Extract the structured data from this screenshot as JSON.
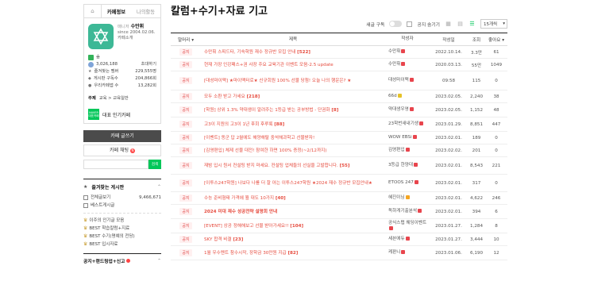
{
  "sidebar": {
    "tabs": [
      "카페정보",
      "나의활동"
    ],
    "manager": {
      "role": "매니저",
      "name": "수만휘",
      "since": "since 2004.02.06.",
      "intro": "카페소개"
    },
    "stats": {
      "grade": "숲",
      "members": "3,026,188",
      "invite": "초대하기",
      "fav_members_label": "즐겨찾는 멤버",
      "fav_members_value": "229,555명",
      "subscribe_label": "게시판 구독수",
      "subscribe_value": "204,866회",
      "town_label": "우리카페앱 수",
      "town_value": "13,282회"
    },
    "subject": {
      "label": "주제",
      "value": "교육 > 교육일반"
    },
    "ranking": {
      "badge": "NAVER 대표카페",
      "label": "대표 인기카페"
    },
    "write_button": "카페 글쓰기",
    "chat_button": "카페 채팅",
    "search_button": "검색",
    "favorites_title": "즐겨찾는 게시판",
    "menu": [
      {
        "label": "전체글보기",
        "value": "9,466,671"
      },
      {
        "label": "베스트게시글",
        "value": ""
      }
    ],
    "best_menu": [
      {
        "label": "이주의 인기글 모음"
      },
      {
        "label": "BEST 학습칼럼+지료"
      },
      {
        "label": "BEST 수기(명예의 전당)"
      },
      {
        "label": "BEST 입시자료"
      }
    ],
    "bottom_title": "공지+랜드링업+신고"
  },
  "main": {
    "title": "칼럼+수기+자료 기고",
    "toolbar": {
      "subscribe": "새글 구독",
      "hide_notice": "공지 숨기기",
      "per_page": "15개씩"
    },
    "headers": {
      "head": "말머리",
      "title": "제목",
      "author": "작성자",
      "date": "작성일",
      "views": "조회",
      "likes": "좋아요"
    },
    "rows": [
      {
        "head": "공지",
        "title": "수만휘 스피드타, 기숙학원 재수 정규반 모집 안내",
        "comments": "[522]",
        "author": "수만휘",
        "level": "r",
        "date": "2022.10.14.",
        "views": "3.3만",
        "likes": "61",
        "bold": false
      },
      {
        "head": "공지",
        "title": "현재 가장 인강패스+권 사장 주요 교육기관 이벤트 모음-2.5 update",
        "comments": "",
        "author": "수만휘",
        "level": "r",
        "date": "2020.03.13.",
        "views": "55만",
        "likes": "1049",
        "bold": false
      },
      {
        "head": "공지",
        "title": "[대성마이맥] ★마이맥터로★ 신규회원 100% 선물 당첨! 오늘 나의 행운은? ★",
        "comments": "",
        "author": "대성마이맥",
        "level": "r",
        "date": "09:58",
        "views": "115",
        "likes": "0",
        "bold": false
      },
      {
        "head": "공지",
        "title": "모두 소환 받고 가세요",
        "comments": "[218]",
        "author": "66d",
        "level": "y",
        "date": "2023.02.05.",
        "views": "2,240",
        "likes": "38",
        "bold": false
      },
      {
        "head": "공지",
        "title": "[학원] 상위 1.3% 약대생이 알려주는 1등급 받는 공부방법 - 단권화",
        "comments": "[8]",
        "author": "약대생우영",
        "level": "r",
        "date": "2023.02.05.",
        "views": "1,152",
        "likes": "48",
        "bold": false
      },
      {
        "head": "공지",
        "title": "고3이 지원의 고3이 1년 후회 후루룩",
        "comments": "[88]",
        "author": "23학번새내기생",
        "level": "r",
        "date": "2023.01.29.",
        "views": "8,851",
        "likes": "447",
        "bold": false
      },
      {
        "head": "공지",
        "title": "[이벤트] 동군 답 2월에도 해양해탈 중석해과학고 선물받자!",
        "comments": "",
        "author": "WOW EBSi",
        "level": "r",
        "date": "2023.02.01.",
        "views": "189",
        "likes": "0",
        "bold": false
      },
      {
        "head": "공지",
        "title": "[김영편입] 체제 선물 대전! 참여한 하면 100% 증정(~2/12까지)",
        "comments": "",
        "author": "김영편입",
        "level": "r",
        "date": "2023.02.02.",
        "views": "201",
        "likes": "0",
        "bold": false
      },
      {
        "head": "공지",
        "title": "재밤 입시 원서 컨설팅 받지 마세요. 컨설팅 업체들의 선실을 고발합니다.",
        "comments": "[55]",
        "author": "3등급 한양대",
        "level": "r",
        "date": "2023.02.01.",
        "views": "8,543",
        "likes": "221",
        "bold": false
      },
      {
        "head": "공지",
        "title": "[이투스247학원] 나보다 나를 더 잘 아는 이투스247학원 ★2024 재수 정규반 모집안내★",
        "comments": "",
        "author": "ETOOS 247",
        "level": "r",
        "date": "2023.02.01.",
        "views": "317",
        "likes": "0",
        "bold": false
      },
      {
        "head": "공지",
        "title": "수능 준비형태 가격에 뭘 대도 10가지",
        "comments": "[40]",
        "author": "혜진이님",
        "level": "o",
        "date": "2023.02.01.",
        "views": "4,622",
        "likes": "246",
        "bold": false
      },
      {
        "head": "공지",
        "title": "2024 미대 재수 성공전략 설명회 안내",
        "comments": "",
        "author": "독하게기출분석",
        "level": "r",
        "date": "2023.02.01.",
        "views": "394",
        "likes": "6",
        "bold": true
      },
      {
        "head": "공지",
        "title": "[EVENT] 상공 정해해보고 선물 받아가세요!!",
        "comments": "[104]",
        "author": "공식스탭 웨딩이벤트",
        "level": "r",
        "date": "2023.01.27.",
        "views": "1,284",
        "likes": "8",
        "bold": false
      },
      {
        "head": "공지",
        "title": "SKY 합격 비결",
        "comments": "[23]",
        "author": "세븐에듀",
        "level": "r",
        "date": "2023.01.27.",
        "views": "3,444",
        "likes": "10",
        "bold": false
      },
      {
        "head": "공지",
        "title": "1월 우수멘트 참수시작, 장학금 30만원 지급",
        "comments": "[82]",
        "author": "케판니",
        "level": "r",
        "date": "2023.01.06.",
        "views": "6,190",
        "likes": "12",
        "bold": false
      }
    ]
  }
}
